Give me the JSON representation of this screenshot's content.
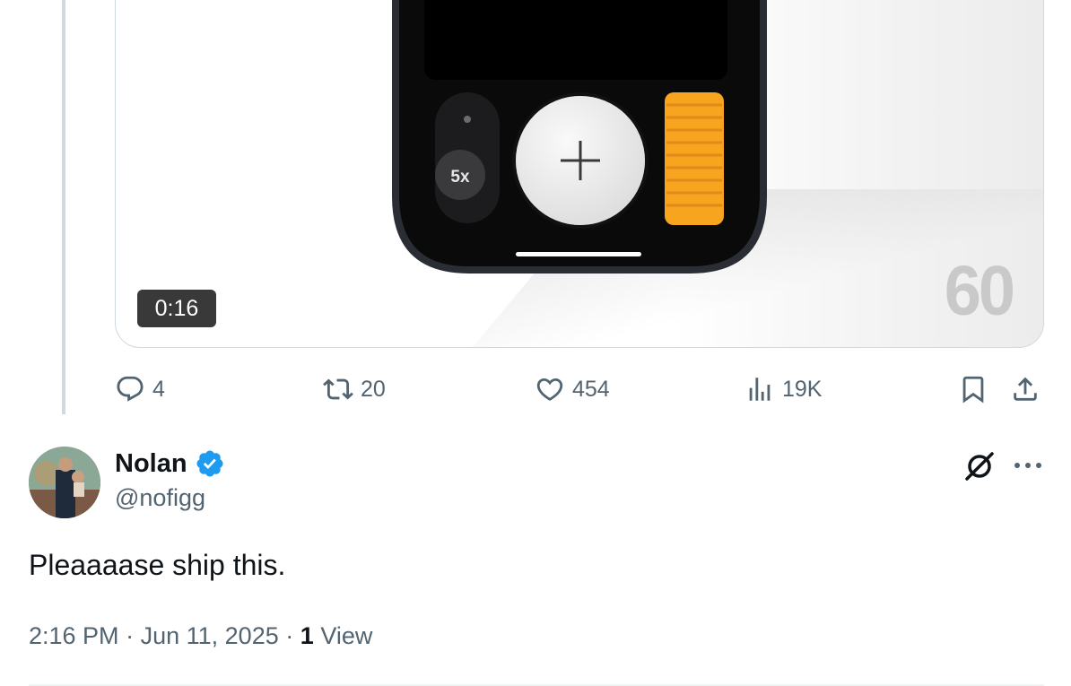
{
  "media": {
    "duration": "0:16",
    "frame_number": "60",
    "phone_zoom_label": "5x"
  },
  "actions": {
    "replies": "4",
    "reposts": "20",
    "likes": "454",
    "views": "19K"
  },
  "reply": {
    "author_name": "Nolan",
    "handle": "@nofigg",
    "text": "Pleaaaase ship this.",
    "time": "2:16 PM",
    "separator": "·",
    "date": "Jun 11, 2025",
    "view_count": "1",
    "view_label": "View"
  },
  "icons": {
    "reply": "reply-icon",
    "repost": "repost-icon",
    "like": "heart-icon",
    "views": "views-icon",
    "bookmark": "bookmark-icon",
    "share": "share-icon",
    "verified": "verified-badge-icon",
    "grok": "grok-icon",
    "more": "more-icon"
  },
  "colors": {
    "text_primary": "#0f1419",
    "text_secondary": "#536471",
    "verified_blue": "#1d9bf0",
    "border": "#cfd9de",
    "dial_orange": "#f7a51f"
  }
}
